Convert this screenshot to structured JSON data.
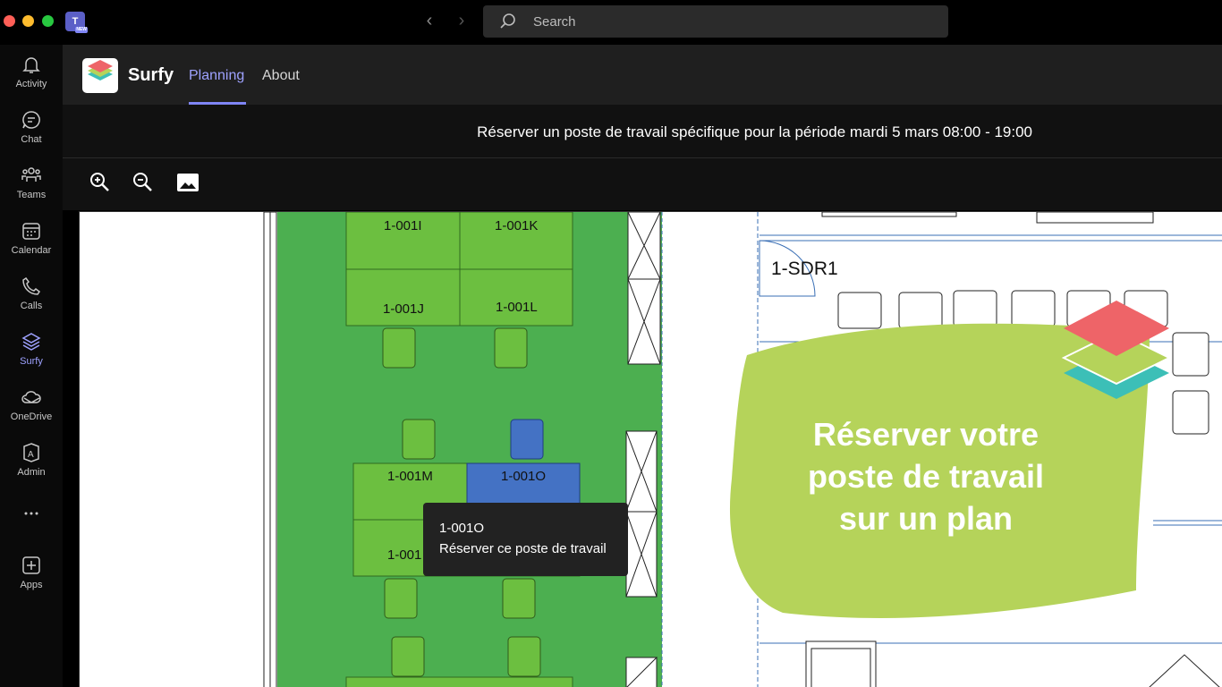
{
  "window": {
    "search_placeholder": "Search",
    "badge_new": "NEW",
    "teams_letter": "T"
  },
  "rail": {
    "items": [
      {
        "label": "Activity",
        "icon": "bell-icon"
      },
      {
        "label": "Chat",
        "icon": "chat-icon"
      },
      {
        "label": "Teams",
        "icon": "teams-icon"
      },
      {
        "label": "Calendar",
        "icon": "calendar-icon"
      },
      {
        "label": "Calls",
        "icon": "phone-icon"
      },
      {
        "label": "Surfy",
        "icon": "layers-icon",
        "active": true
      },
      {
        "label": "OneDrive",
        "icon": "cloud-icon"
      },
      {
        "label": "Admin",
        "icon": "admin-icon"
      },
      {
        "label": "...",
        "icon": "more-icon"
      },
      {
        "label": "Apps",
        "icon": "add-app-icon"
      }
    ]
  },
  "app": {
    "name": "Surfy",
    "tabs": [
      {
        "label": "Planning",
        "active": true
      },
      {
        "label": "About",
        "active": false
      }
    ]
  },
  "period": {
    "text": "Réserver un poste de travail spécifique pour la période mardi 5 mars 08:00 - 19:00"
  },
  "toolbar": {
    "icons": [
      "zoom-in-icon",
      "zoom-out-icon",
      "image-icon"
    ]
  },
  "plan": {
    "desks": [
      "1-001I",
      "1-001K",
      "1-001J",
      "1-001L",
      "1-001M",
      "1-001O",
      "1-001"
    ],
    "room_label": "1-SDR1",
    "tooltip": {
      "desk_id": "1-001O",
      "action": "Réserver ce poste de travail"
    },
    "promo": {
      "line1": "Réserver votre",
      "line2": "poste de travail",
      "line3": "sur un plan"
    }
  },
  "colors": {
    "accent": "#7f85f5",
    "zone_green": "#4caf50",
    "desk_green": "#6cbf40",
    "desk_selected": "#4472c4",
    "promo_lime": "#b5d35a",
    "logo_red": "#ee6468",
    "logo_teal": "#3cbfb7"
  }
}
